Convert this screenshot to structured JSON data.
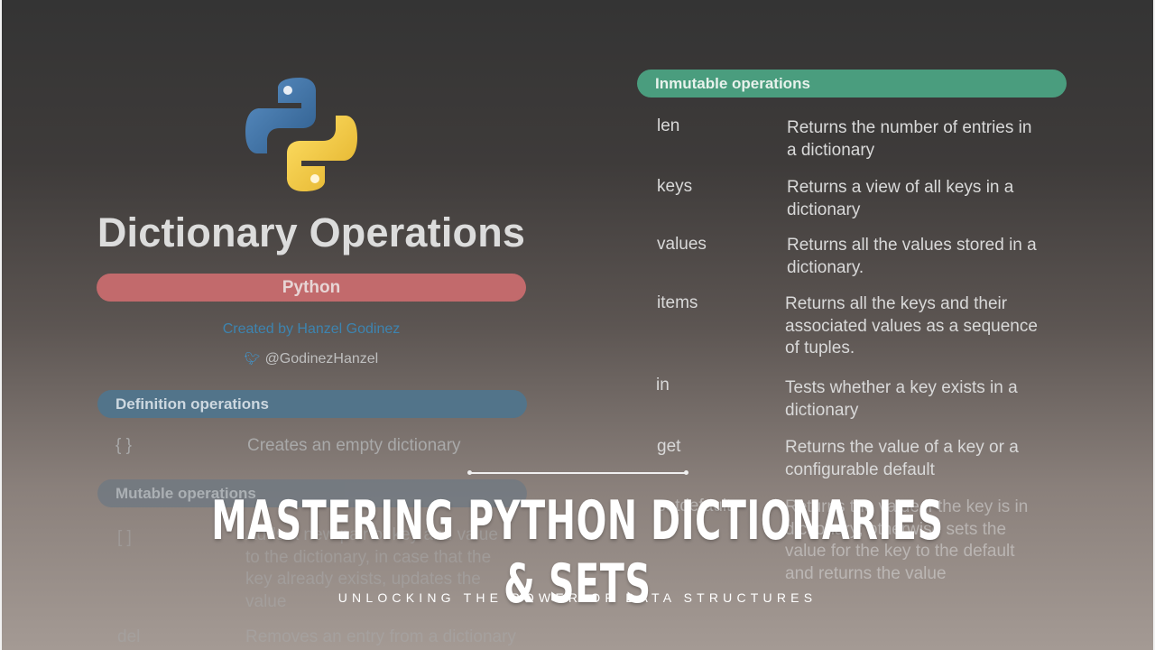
{
  "header": {
    "main_title": "Dictionary Operations",
    "subtitle_pill": "Python",
    "created_by": "Created by Hanzel Godinez",
    "handle": "@GodinezHanzel"
  },
  "sections": {
    "definition": {
      "title": "Definition operations",
      "rows": [
        {
          "key": "{ }",
          "desc": "Creates an empty dictionary"
        }
      ]
    },
    "mutable": {
      "title": "Mutable operations",
      "rows": [
        {
          "key": "[ ]",
          "desc": [
            "Adds a new pair of key and value",
            "to the dictionary, in case that the",
            "key already exists, updates the",
            "value"
          ]
        },
        {
          "key": "del",
          "desc": [
            "Removes an entry from a dictionary"
          ]
        }
      ]
    },
    "inmutable": {
      "title": "Inmutable operations",
      "rows": [
        {
          "key": "len",
          "desc": [
            "Returns the number of entries in",
            "a dictionary"
          ]
        },
        {
          "key": "keys",
          "desc": [
            "Returns a view of all keys in a",
            "dictionary"
          ]
        },
        {
          "key": "values",
          "desc": [
            "Returns all the values stored in a",
            "dictionary."
          ]
        },
        {
          "key": "items",
          "desc": [
            "Returns all the keys and their",
            "associated values as a sequence",
            "of tuples."
          ]
        },
        {
          "key": "in",
          "desc": [
            "Tests whether a key exists in a",
            "dictionary"
          ]
        },
        {
          "key": "get",
          "desc": [
            "Returns the value of a key or a",
            "configurable default"
          ]
        },
        {
          "key": "setdefault",
          "desc": [
            "Returns the value if the key is in",
            "dictionary; otherwise sets the",
            "value for the key to the default",
            "and returns the value"
          ]
        }
      ]
    }
  },
  "overlay": {
    "title": "MASTERING PYTHON DICTIONARIES & SETS",
    "subtitle": "UNLOCKING THE POWER OF DATA STRUCTURES"
  },
  "icons": {
    "logo": "python-logo-icon",
    "bird": "twitter-bird-icon"
  },
  "colors": {
    "python_pill": "#c26a6c",
    "definition_pill": "#52748a",
    "inmutable_pill": "#4a9d7e",
    "python_blue": "#3c6e9e",
    "python_yellow": "#f2c63b"
  }
}
